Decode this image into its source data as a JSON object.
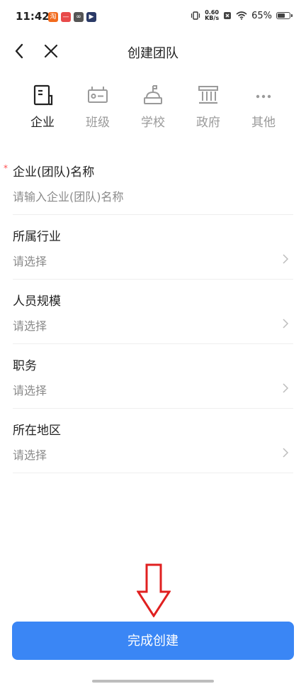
{
  "status_bar": {
    "time": "11:42",
    "net_speed_value": "0.60",
    "net_speed_unit": "KB/s",
    "battery": "65%",
    "battery_level": 0.65
  },
  "nav": {
    "title": "创建团队"
  },
  "team_types": [
    {
      "label": "企业",
      "icon": "building-document-icon",
      "active": true
    },
    {
      "label": "班级",
      "icon": "class-card-icon",
      "active": false
    },
    {
      "label": "学校",
      "icon": "school-bell-icon",
      "active": false
    },
    {
      "label": "政府",
      "icon": "government-building-icon",
      "active": false
    },
    {
      "label": "其他",
      "icon": "more-dots-icon",
      "active": false
    }
  ],
  "form": {
    "required_mark": "*",
    "fields": [
      {
        "label": "企业(团队)名称",
        "placeholder": "请输入企业(团队)名称",
        "required": true
      },
      {
        "label": "所属行业",
        "value": "请选择"
      },
      {
        "label": "人员规模",
        "value": "请选择"
      },
      {
        "label": "职务",
        "value": "请选择"
      },
      {
        "label": "所在地区",
        "value": "请选择"
      }
    ]
  },
  "submit_label": "完成创建",
  "colors": {
    "primary": "#3a86f5",
    "annotation_arrow": "#e02020",
    "required": "#ff4d4f"
  }
}
